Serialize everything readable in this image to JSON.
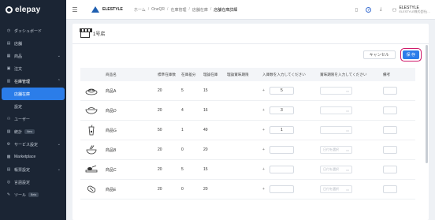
{
  "app": {
    "logo_text": "elepay"
  },
  "sidebar": {
    "items": [
      {
        "label": "ダッシュボード",
        "icon": "clock-icon",
        "chevron": ""
      },
      {
        "label": "店舗",
        "icon": "store-icon",
        "chevron": ""
      },
      {
        "label": "商品",
        "icon": "product-icon",
        "chevron": "⌄"
      },
      {
        "label": "注文",
        "icon": "order-icon",
        "chevron": ""
      },
      {
        "label": "在庫管理",
        "icon": "stock-icon",
        "chevron": "⌃"
      }
    ],
    "sub_items": [
      {
        "label": "店舗在庫",
        "active": true
      },
      {
        "label": "設定",
        "active": false
      }
    ],
    "items_after": [
      {
        "label": "ユーザー",
        "icon": "user-icon",
        "chevron": ""
      },
      {
        "label": "統計",
        "icon": "chart-icon",
        "chevron": "",
        "badge": "New"
      },
      {
        "label": "サービス設定",
        "icon": "gear-icon",
        "chevron": "⌄"
      },
      {
        "label": "Marketplace",
        "icon": "marketplace-icon",
        "chevron": ""
      },
      {
        "label": "帳票設定",
        "icon": "report-icon",
        "chevron": "⌄"
      },
      {
        "label": "言語設定",
        "icon": "globe-icon",
        "chevron": ""
      },
      {
        "label": "ツール",
        "icon": "tool-icon",
        "chevron": "",
        "badge": "Beta"
      }
    ]
  },
  "header": {
    "brand": "ELESTYLE",
    "breadcrumbs": [
      "ホーム",
      "OneQR",
      "在庫管理",
      "店舗在庫",
      "店舗在庫詳細"
    ],
    "user_name": "ELESTYLE",
    "user_company": "ELESTYLE株式会社(…"
  },
  "card": {
    "store_name": "1号店"
  },
  "actions": {
    "cancel_label": "キャンセル",
    "save_label": "保 存"
  },
  "table": {
    "headers": {
      "name": "商品名",
      "std": "標準在庫数",
      "diff": "在庫差分",
      "stock": "理論在庫",
      "expiry": "理論賞味期限",
      "qty": "入庫数を入力してください",
      "date": "賞味期限を入力してください",
      "note": "備考"
    },
    "date_placeholder": "日付を選択",
    "plus": "+",
    "rows": [
      {
        "name": "商品A",
        "std": "20",
        "diff": "5",
        "stock": "15",
        "qty": "5",
        "icon": "dish-icon"
      },
      {
        "name": "商品D",
        "std": "20",
        "diff": "4",
        "stock": "16",
        "qty": "3",
        "icon": "bowl-icon"
      },
      {
        "name": "商品G",
        "std": "50",
        "diff": "1",
        "stock": "49",
        "qty": "1",
        "icon": "drink-icon"
      },
      {
        "name": "商品B",
        "std": "20",
        "diff": "0",
        "stock": "20",
        "qty": "",
        "icon": "noodle-icon"
      },
      {
        "name": "商品C",
        "std": "20",
        "diff": "5",
        "stock": "15",
        "qty": "",
        "icon": "plate-icon"
      },
      {
        "name": "商品E",
        "std": "20",
        "diff": "0",
        "stock": "20",
        "qty": "",
        "icon": "snack-icon"
      }
    ]
  },
  "colors": {
    "sidebar_bg": "#1b2534",
    "accent": "#2b7de9",
    "save_outline": "#d01a6a"
  }
}
